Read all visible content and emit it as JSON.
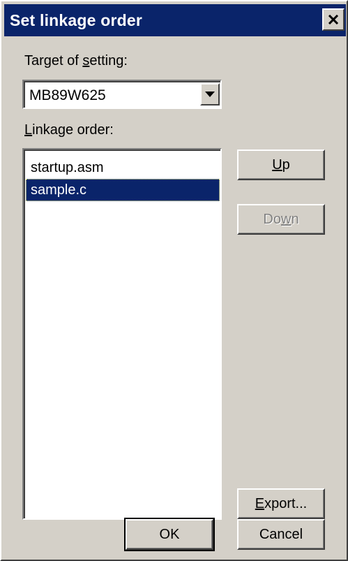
{
  "window": {
    "title": "Set linkage order"
  },
  "target": {
    "label_pre": "Target of ",
    "label_accel": "s",
    "label_post": "etting:",
    "selected_value": "MB89W625"
  },
  "linkage": {
    "label_accel": "L",
    "label_post": "inkage order:",
    "items": [
      {
        "label": "startup.asm",
        "selected": false
      },
      {
        "label": "sample.c",
        "selected": true
      }
    ]
  },
  "buttons": {
    "up_accel": "U",
    "up_rest": "p",
    "down_pre": "Do",
    "down_accel": "w",
    "down_post": "n",
    "export_accel": "E",
    "export_rest": "xport...",
    "ok": "OK",
    "cancel": "Cancel"
  },
  "icons": {
    "close": "close-icon",
    "dropdown": "chevron-down-icon"
  },
  "colors": {
    "titlebar": "#0a246a",
    "face": "#d4d0c8",
    "selection": "#0a246a"
  }
}
